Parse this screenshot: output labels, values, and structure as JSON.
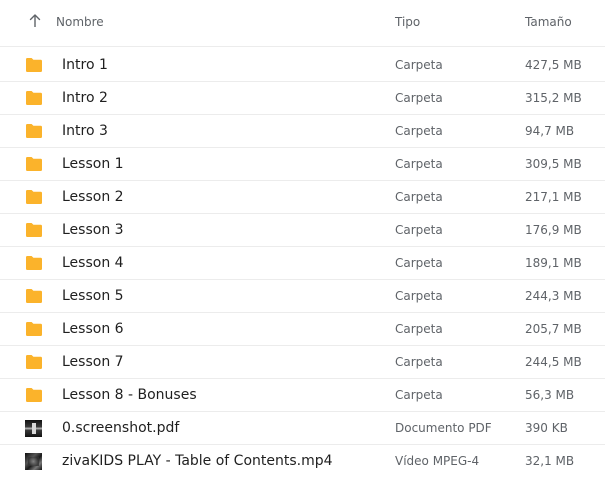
{
  "header": {
    "name_label": "Nombre",
    "type_label": "Tipo",
    "size_label": "Tamaño"
  },
  "colors": {
    "folder": "#fbb32b",
    "text": "#1f1f1f",
    "secondary_text": "#5f6368",
    "divider": "#ececec"
  },
  "rows": [
    {
      "name": "Intro 1",
      "type": "Carpeta",
      "size": "427,5 MB",
      "icon": "folder-icon"
    },
    {
      "name": "Intro 2",
      "type": "Carpeta",
      "size": "315,2 MB",
      "icon": "folder-icon"
    },
    {
      "name": "Intro 3",
      "type": "Carpeta",
      "size": "94,7 MB",
      "icon": "folder-icon"
    },
    {
      "name": "Lesson 1",
      "type": "Carpeta",
      "size": "309,5 MB",
      "icon": "folder-icon"
    },
    {
      "name": "Lesson 2",
      "type": "Carpeta",
      "size": "217,1 MB",
      "icon": "folder-icon"
    },
    {
      "name": "Lesson 3",
      "type": "Carpeta",
      "size": "176,9 MB",
      "icon": "folder-icon"
    },
    {
      "name": "Lesson 4",
      "type": "Carpeta",
      "size": "189,1 MB",
      "icon": "folder-icon"
    },
    {
      "name": "Lesson 5",
      "type": "Carpeta",
      "size": "244,3 MB",
      "icon": "folder-icon"
    },
    {
      "name": "Lesson 6",
      "type": "Carpeta",
      "size": "205,7 MB",
      "icon": "folder-icon"
    },
    {
      "name": "Lesson 7",
      "type": "Carpeta",
      "size": "244,5 MB",
      "icon": "folder-icon"
    },
    {
      "name": "Lesson 8 - Bonuses",
      "type": "Carpeta",
      "size": "56,3 MB",
      "icon": "folder-icon"
    },
    {
      "name": "0.screenshot.pdf",
      "type": "Documento PDF",
      "size": "390 KB",
      "icon": "pdf-thumbnail"
    },
    {
      "name": "zivaKIDS PLAY - Table of Contents.mp4",
      "type": "Vídeo MPEG-4",
      "size": "32,1 MB",
      "icon": "video-thumbnail"
    }
  ]
}
